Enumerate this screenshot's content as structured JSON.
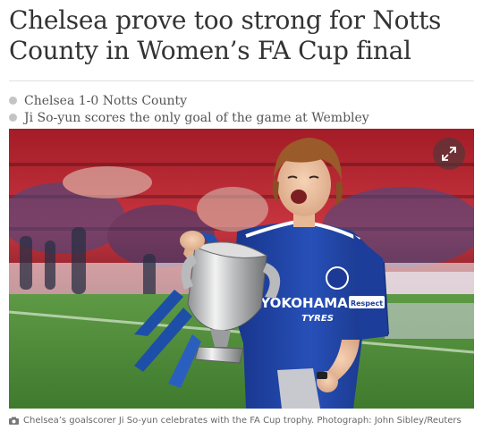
{
  "article": {
    "headline_line1": "Chelsea prove too strong for Notts",
    "headline_line2": "County in Women’s FA Cup final",
    "standfirst": [
      "Chelsea 1-0 Notts County",
      "Ji So-yun scores the only goal of the game at Wembley"
    ]
  },
  "photo": {
    "expand_icon": "expand-arrows-icon",
    "shirt_sponsor": "YOKOHAMA",
    "shirt_sponsor_sub": "TYRES",
    "sleeve_badge": "Respect"
  },
  "caption": {
    "icon": "camera-icon",
    "text": "Chelsea’s goalscorer Ji So-yun celebrates with the FA Cup trophy. Photograph: John Sibley/Reuters"
  },
  "colors": {
    "headline": "#333333",
    "bullet": "#c4c4c4",
    "kit_blue": "#1f3f9e",
    "stand_red": "#b3212c",
    "pitch_green": "#4f8a3a"
  }
}
